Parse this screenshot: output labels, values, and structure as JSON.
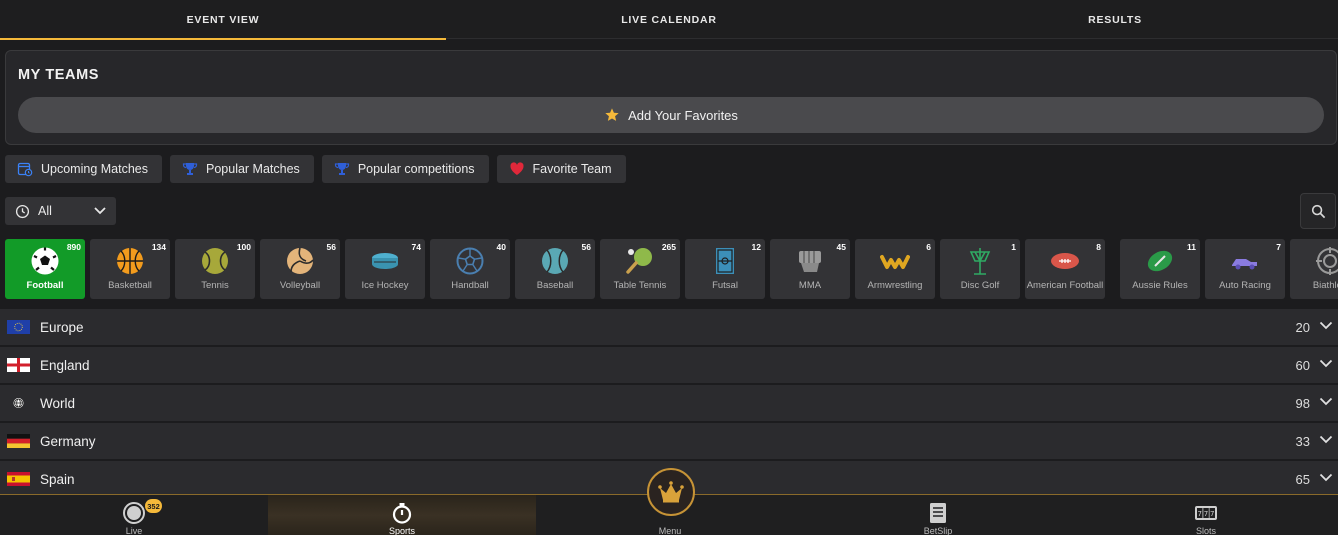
{
  "tabs": [
    {
      "label": "EVENT VIEW",
      "active": true
    },
    {
      "label": "LIVE CALENDAR",
      "active": false
    },
    {
      "label": "RESULTS",
      "active": false
    }
  ],
  "my_teams": {
    "title": "MY TEAMS",
    "add_favorites_label": "Add Your Favorites",
    "star_icon": "star-icon"
  },
  "filter_chips": [
    {
      "label": "Upcoming Matches",
      "icon": "calendar-clock-icon"
    },
    {
      "label": "Popular Matches",
      "icon": "trophy-icon"
    },
    {
      "label": "Popular competitions",
      "icon": "trophy-icon"
    },
    {
      "label": "Favorite Team",
      "icon": "heart-icon"
    }
  ],
  "time_filter": {
    "selected": "All",
    "icon": "clock-icon"
  },
  "search_icon": "search-icon",
  "sports": [
    {
      "name": "Football",
      "count": "890",
      "icon": "football-icon",
      "active": true
    },
    {
      "name": "Basketball",
      "count": "134",
      "icon": "basketball-icon"
    },
    {
      "name": "Tennis",
      "count": "100",
      "icon": "tennis-icon"
    },
    {
      "name": "Volleyball",
      "count": "56",
      "icon": "volleyball-icon"
    },
    {
      "name": "Ice Hockey",
      "count": "74",
      "icon": "ice-hockey-icon"
    },
    {
      "name": "Handball",
      "count": "40",
      "icon": "handball-icon"
    },
    {
      "name": "Baseball",
      "count": "56",
      "icon": "baseball-icon"
    },
    {
      "name": "Table Tennis",
      "count": "265",
      "icon": "table-tennis-icon"
    },
    {
      "name": "Futsal",
      "count": "12",
      "icon": "futsal-icon"
    },
    {
      "name": "MMA",
      "count": "45",
      "icon": "mma-icon"
    },
    {
      "name": "Armwrestling",
      "count": "6",
      "icon": "armwrestling-icon"
    },
    {
      "name": "Disc Golf",
      "count": "1",
      "icon": "disc-golf-icon"
    },
    {
      "name": "American Football",
      "count": "8",
      "icon": "american-football-icon"
    },
    {
      "name": "Aussie Rules",
      "count": "11",
      "icon": "aussie-rules-icon"
    },
    {
      "name": "Auto Racing",
      "count": "7",
      "icon": "auto-racing-icon"
    },
    {
      "name": "Biathlon",
      "count": "",
      "icon": "biathlon-icon"
    }
  ],
  "countries": [
    {
      "name": "Europe",
      "count": "20",
      "flag": "eu-flag-icon"
    },
    {
      "name": "England",
      "count": "60",
      "flag": "england-flag-icon"
    },
    {
      "name": "World",
      "count": "98",
      "flag": "globe-icon"
    },
    {
      "name": "Germany",
      "count": "33",
      "flag": "germany-flag-icon"
    },
    {
      "name": "Spain",
      "count": "65",
      "flag": "spain-flag-icon"
    }
  ],
  "bottom_nav": [
    {
      "label": "Live",
      "icon": "live-icon",
      "badge": "352"
    },
    {
      "label": "Sports",
      "icon": "stopwatch-icon",
      "active": true
    },
    {
      "label": "Menu",
      "icon": "crown-icon"
    },
    {
      "label": "BetSlip",
      "icon": "betslip-icon"
    },
    {
      "label": "Slots",
      "icon": "slots-icon"
    }
  ],
  "colors": {
    "accent": "#f5b93a",
    "active_sport": "#129b28",
    "background": "#1c1c1e",
    "row": "#2b2b2e"
  }
}
